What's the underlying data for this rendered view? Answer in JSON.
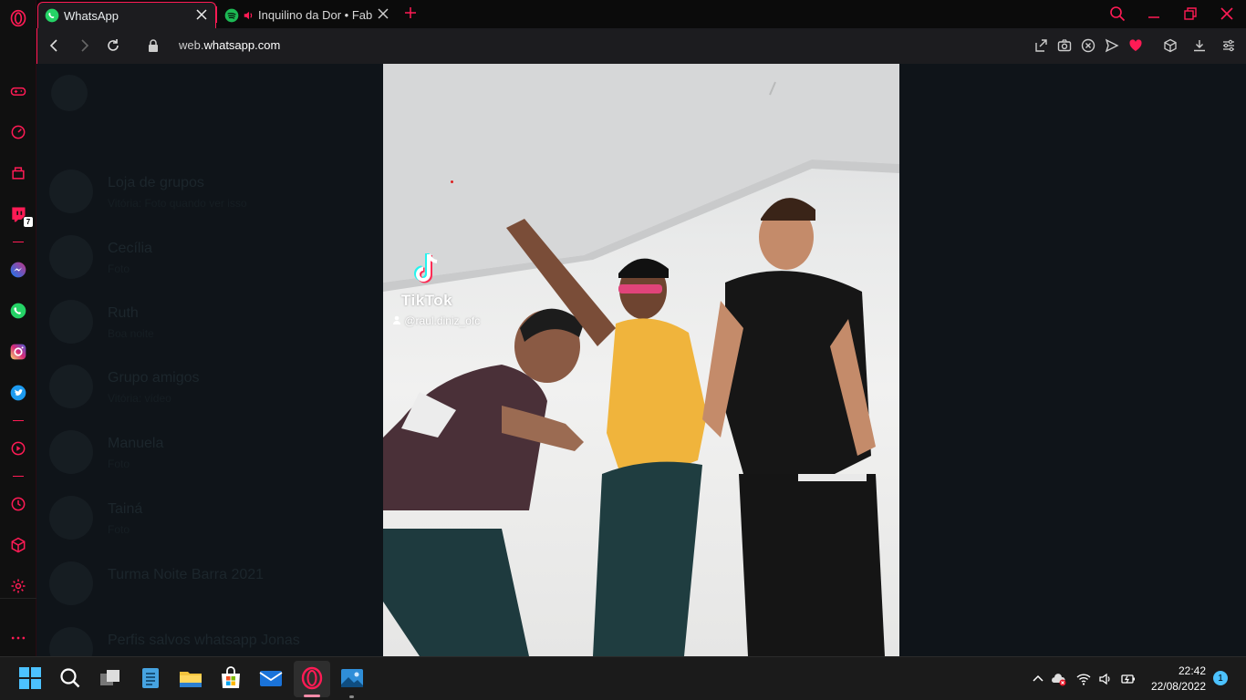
{
  "browser": {
    "tabs": [
      {
        "title": "WhatsApp",
        "icon": "whatsapp-icon",
        "active": true
      },
      {
        "title": "Inquilino da Dor • Fabio",
        "icon": "spotify-icon",
        "audio": true,
        "active": false
      }
    ],
    "address": {
      "prefix": "web.",
      "domain": "whatsapp.com"
    },
    "accent": "#ff1b55"
  },
  "sidebar": {
    "twitch_badge": "7"
  },
  "whatsapp": {
    "chats": [
      {
        "name": "Loja de grupos",
        "sub": "Vitória: Foto quando ver isso"
      },
      {
        "name": "Cecília",
        "sub": "Foto"
      },
      {
        "name": "Ruth",
        "sub": "Boa noite"
      },
      {
        "name": "Grupo amigos",
        "sub": "Vitória: vídeo"
      },
      {
        "name": "Manuela",
        "sub": "Foto"
      },
      {
        "name": "Tainá",
        "sub": "Foto"
      },
      {
        "name": "Turma Noite Barra 2021",
        "sub": ""
      },
      {
        "name": "Perfis salvos whatsapp Jonas",
        "sub": ""
      }
    ]
  },
  "video": {
    "brand": "TikTok",
    "user": "@raul.diniz_ofc"
  },
  "taskbar": {
    "time": "22:42",
    "date": "22/08/2022",
    "notifications": "1"
  }
}
